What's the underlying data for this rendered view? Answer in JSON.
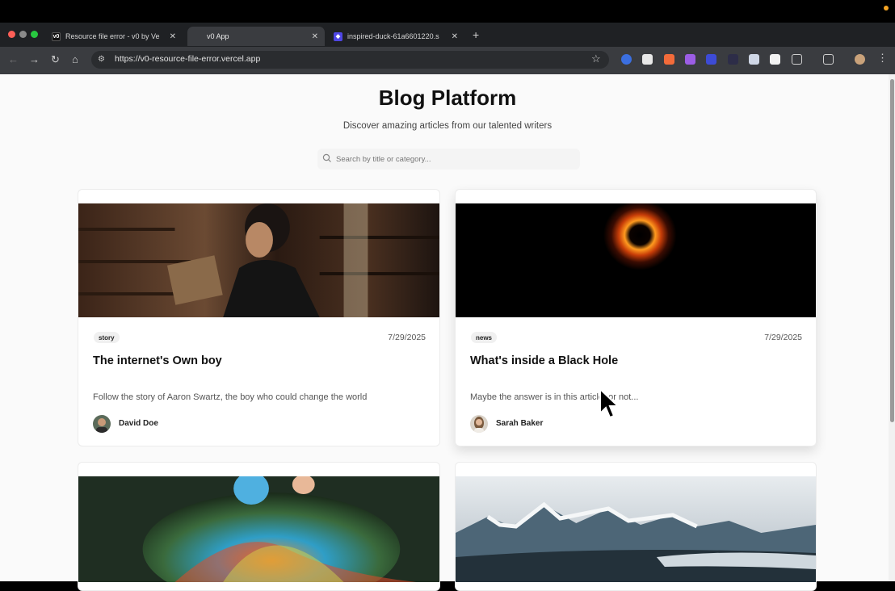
{
  "browser": {
    "tabs": [
      {
        "label": "Resource file error - v0 by Ve",
        "favicon_text": "v0"
      },
      {
        "label": "v0 App",
        "favicon_text": ""
      },
      {
        "label": "inspired-duck-61a6601220.s",
        "favicon_text": ""
      }
    ],
    "url": "https://v0-resource-file-error.vercel.app"
  },
  "page": {
    "title": "Blog Platform",
    "subtitle": "Discover amazing articles from our talented writers",
    "search": {
      "placeholder": "Search by title or category..."
    }
  },
  "posts": [
    {
      "category": "story",
      "date": "7/29/2025",
      "title": "The internet's Own boy",
      "excerpt": "Follow the story of Aaron Swartz, the boy who could change the world",
      "author": "David Doe"
    },
    {
      "category": "news",
      "date": "7/29/2025",
      "title": "What's inside a Black Hole",
      "excerpt": "Maybe the answer is in this article, or not...",
      "author": "Sarah Baker"
    },
    {
      "category": "",
      "date": "",
      "title": "",
      "excerpt": "",
      "author": ""
    },
    {
      "category": "",
      "date": "",
      "title": "",
      "excerpt": "",
      "author": ""
    }
  ],
  "colors": {
    "tab_strip": "#1f2124",
    "toolbar": "#3a3c40",
    "page_bg": "#fafafa",
    "title_text": "#111111"
  }
}
